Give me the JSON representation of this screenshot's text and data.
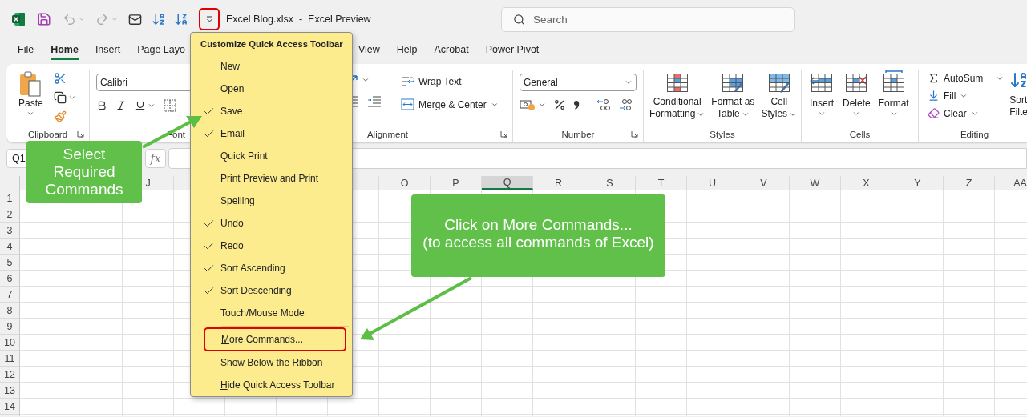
{
  "window": {
    "title": "Excel Blog.xlsx  -  Excel Preview"
  },
  "qat_menu_button": {
    "highlighted": true
  },
  "search": {
    "placeholder": "Search"
  },
  "tabs": [
    {
      "label": "File",
      "selected": false
    },
    {
      "label": "Home",
      "selected": true
    },
    {
      "label": "Insert",
      "selected": false
    },
    {
      "label": "Page Layo",
      "selected": false
    },
    {
      "label": "View",
      "selected": false
    },
    {
      "label": "Help",
      "selected": false
    },
    {
      "label": "Acrobat",
      "selected": false
    },
    {
      "label": "Power Pivot",
      "selected": false
    }
  ],
  "ribbon": {
    "clipboard": {
      "label": "Clipboard",
      "paste": "Paste"
    },
    "font": {
      "label": "Font",
      "font_name": "Calibri"
    },
    "alignment": {
      "label": "Alignment",
      "wrap_text": "Wrap Text",
      "merge": "Merge & Center"
    },
    "number": {
      "label": "Number",
      "format": "General"
    },
    "styles": {
      "label": "Styles",
      "buttons": [
        {
          "lines": [
            "Conditional",
            "Formatting"
          ],
          "kind": "conditional"
        },
        {
          "lines": [
            "Format as",
            "Table"
          ],
          "kind": "table"
        },
        {
          "lines": [
            "Cell",
            "Styles"
          ],
          "kind": "cellstyles"
        }
      ]
    },
    "cells": {
      "label": "Cells",
      "buttons": [
        {
          "label": "Insert",
          "kind": "insert"
        },
        {
          "label": "Delete",
          "kind": "delete"
        },
        {
          "label": "Format",
          "kind": "format"
        }
      ]
    },
    "editing": {
      "label": "Editing",
      "autosum": "AutoSum",
      "fill": "Fill",
      "clear": "Clear",
      "sort_lines": [
        "Sort",
        "Filte"
      ]
    }
  },
  "formula_bar": {
    "name_box": "Q1",
    "function_label": "fx"
  },
  "sheet": {
    "columns": [
      {
        "label": "J",
        "selected": false
      },
      {
        "label": "O",
        "selected": false
      },
      {
        "label": "P",
        "selected": false
      },
      {
        "label": "Q",
        "selected": true
      },
      {
        "label": "R",
        "selected": false
      },
      {
        "label": "S",
        "selected": false
      },
      {
        "label": "T",
        "selected": false
      },
      {
        "label": "U",
        "selected": false
      },
      {
        "label": "V",
        "selected": false
      },
      {
        "label": "W",
        "selected": false
      },
      {
        "label": "X",
        "selected": false
      },
      {
        "label": "Y",
        "selected": false
      },
      {
        "label": "Z",
        "selected": false
      },
      {
        "label": "AA",
        "selected": false
      }
    ],
    "rows": [
      "1",
      "2",
      "3",
      "4",
      "5",
      "6",
      "7",
      "8",
      "9",
      "10",
      "11",
      "12",
      "13",
      "14"
    ]
  },
  "menu": {
    "title": "Customize Quick Access Toolbar",
    "items": [
      {
        "label": "New",
        "kind": "toggle",
        "checked": false
      },
      {
        "label": "Open",
        "kind": "toggle",
        "checked": false
      },
      {
        "label": "Save",
        "kind": "toggle",
        "checked": true
      },
      {
        "label": "Email",
        "kind": "toggle",
        "checked": true
      },
      {
        "label": "Quick Print",
        "kind": "toggle",
        "checked": false
      },
      {
        "label": "Print Preview and Print",
        "kind": "toggle",
        "checked": false
      },
      {
        "label": "Spelling",
        "kind": "toggle",
        "checked": false
      },
      {
        "label": "Undo",
        "kind": "toggle",
        "checked": true
      },
      {
        "label": "Redo",
        "kind": "toggle",
        "checked": true
      },
      {
        "label": "Sort Ascending",
        "kind": "toggle",
        "checked": true
      },
      {
        "label": "Sort Descending",
        "kind": "toggle",
        "checked": true
      },
      {
        "label": "Touch/Mouse Mode",
        "kind": "toggle",
        "checked": false
      },
      {
        "label": "More Commands...",
        "kind": "command",
        "underline_first": true,
        "highlighted": true
      },
      {
        "label": "Show Below the Ribbon",
        "kind": "command",
        "underline_first": true,
        "highlighted": false
      },
      {
        "label": "Hide Quick Access Toolbar",
        "kind": "command",
        "underline_first": true,
        "highlighted": false
      }
    ]
  },
  "callouts": [
    {
      "lines": [
        "Select Required Commands"
      ]
    },
    {
      "lines": [
        "Click on More Commands...",
        "(to access all commands of Excel)"
      ]
    }
  ]
}
